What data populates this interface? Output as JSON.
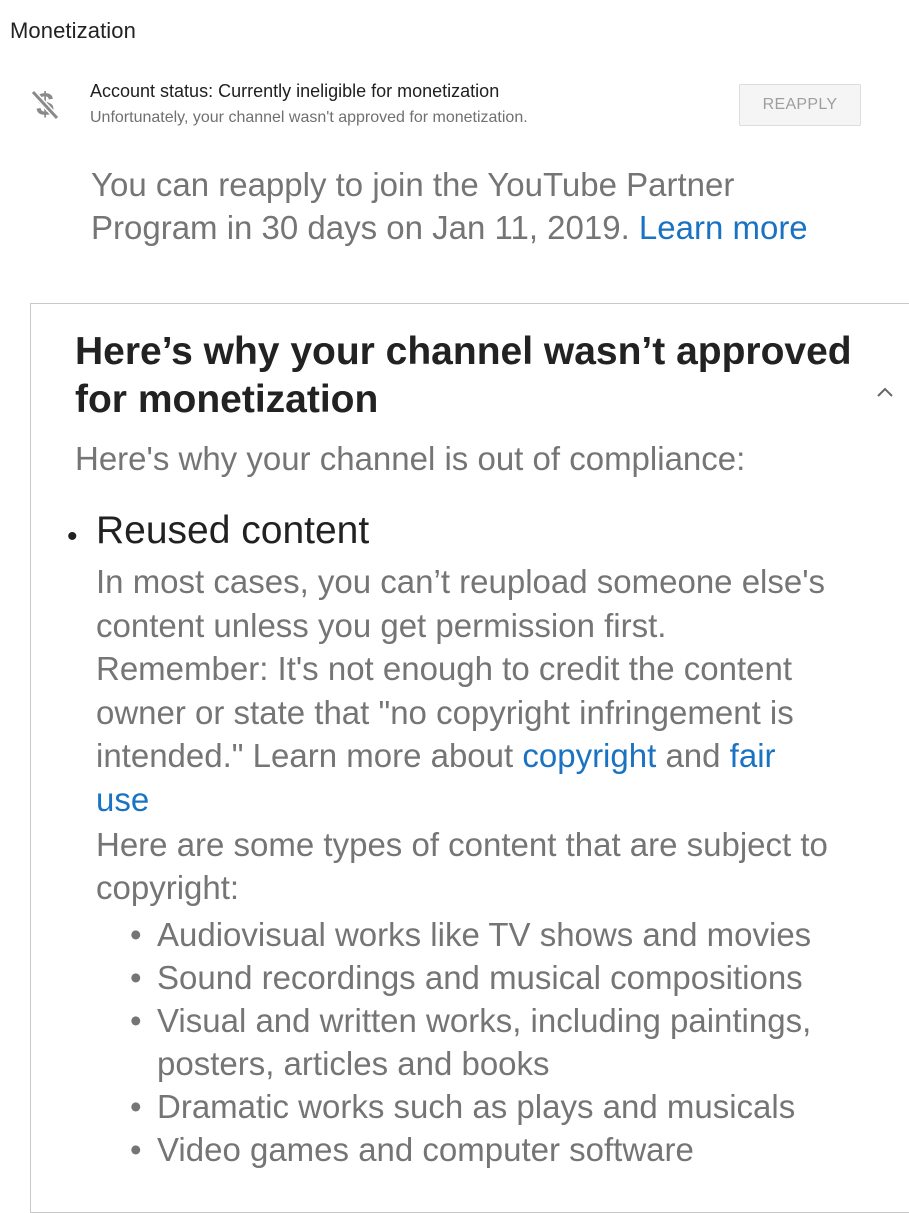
{
  "header": {
    "title": "Monetization"
  },
  "status": {
    "icon": "no-monetization-icon",
    "title": "Account status: Currently ineligible for monetization",
    "subtitle": "Unfortunately, your channel wasn't approved for monetization.",
    "reapply_label": "REAPPLY"
  },
  "reapply_note": {
    "line1": "You can reapply to join the YouTube Partner",
    "line2": "Program in 30 days on Jan 11, 2019.",
    "learn_more": "Learn more"
  },
  "card": {
    "title_line1": "Here’s why your channel wasn’t approved",
    "title_line2": "for monetization",
    "subtitle": "Here's why your channel is out of compliance:",
    "collapse_icon": "chevron-up-icon",
    "reason": {
      "bullet": "•",
      "heading": "Reused content",
      "lines": [
        "In most cases, you can’t reupload someone else's",
        "content unless you get permission first.",
        "Remember: It's not enough to credit the content",
        "owner or state that \"no copyright infringement is"
      ],
      "line5_text": "intended.\" Learn more about",
      "copyright_link": "copyright",
      "and_text": "and",
      "fair_use_link_part1": "fair",
      "fair_use_link_part2": "use",
      "types_intro_line1": "Here are some types of content that are subject to",
      "types_intro_line2": "copyright:",
      "types": [
        "Audiovisual works like TV shows and movies",
        "Sound recordings and musical compositions",
        "Visual and written works, including paintings,",
        "posters, articles and books",
        "Dramatic works such as plays and musicals",
        "Video games and computer software"
      ]
    }
  }
}
